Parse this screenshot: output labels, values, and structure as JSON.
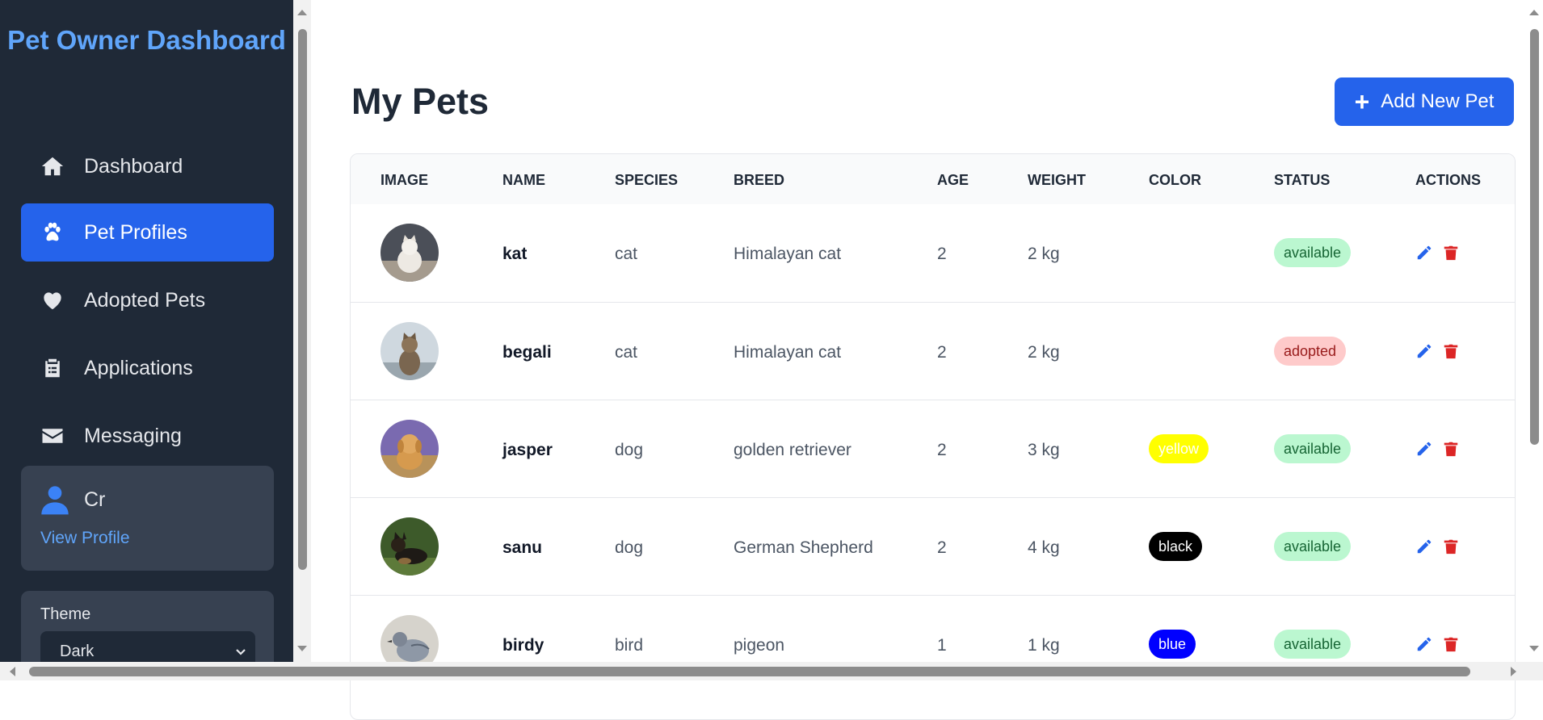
{
  "app": {
    "title": "Pet Owner Dashboard"
  },
  "sidebar": {
    "items": [
      {
        "label": "Dashboard",
        "icon": "home-icon",
        "active": false
      },
      {
        "label": "Pet Profiles",
        "icon": "paw-icon",
        "active": true
      },
      {
        "label": "Adopted Pets",
        "icon": "heart-icon",
        "active": false
      },
      {
        "label": "Applications",
        "icon": "clipboard-icon",
        "active": false
      },
      {
        "label": "Messaging",
        "icon": "envelope-icon",
        "active": false
      }
    ],
    "profile": {
      "name": "Cr",
      "link": "View Profile"
    },
    "theme": {
      "label": "Theme",
      "value": "Dark"
    }
  },
  "main": {
    "title": "My Pets",
    "add_button": "Add New Pet",
    "columns": [
      "IMAGE",
      "NAME",
      "SPECIES",
      "BREED",
      "AGE",
      "WEIGHT",
      "COLOR",
      "STATUS",
      "ACTIONS"
    ],
    "pets": [
      {
        "name": "kat",
        "species": "cat",
        "breed": "Himalayan cat",
        "age": "2",
        "weight": "2 kg",
        "color": "",
        "color_hex": "",
        "status": "available"
      },
      {
        "name": "begali",
        "species": "cat",
        "breed": "Himalayan cat",
        "age": "2",
        "weight": "2 kg",
        "color": "",
        "color_hex": "",
        "status": "adopted"
      },
      {
        "name": "jasper",
        "species": "dog",
        "breed": "golden retriever",
        "age": "2",
        "weight": "3 kg",
        "color": "yellow",
        "color_hex": "#ffff00",
        "status": "available"
      },
      {
        "name": "sanu",
        "species": "dog",
        "breed": "German Shepherd",
        "age": "2",
        "weight": "4 kg",
        "color": "black",
        "color_hex": "#000000",
        "status": "available"
      },
      {
        "name": "birdy",
        "species": "bird",
        "breed": "pigeon",
        "age": "1",
        "weight": "1 kg",
        "color": "blue",
        "color_hex": "#0000ff",
        "status": "available"
      }
    ]
  },
  "colors": {
    "sidebar_bg": "#1f2937",
    "accent": "#2563eb",
    "brand": "#60a5fa",
    "status_available": "#bbf7d0",
    "status_adopted": "#fecaca",
    "edit": "#2563eb",
    "delete": "#dc2626"
  }
}
